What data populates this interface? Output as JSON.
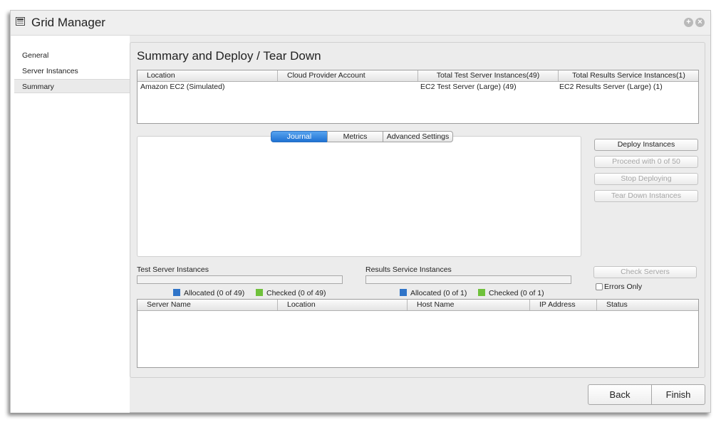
{
  "window": {
    "title": "Grid Manager",
    "icon": "grid-manager-icon"
  },
  "sidebar": {
    "items": [
      {
        "label": "General"
      },
      {
        "label": "Server Instances"
      },
      {
        "label": "Summary",
        "selected": true
      }
    ]
  },
  "main": {
    "title": "Summary and Deploy / Tear Down",
    "summary_table": {
      "columns": [
        "Location",
        "Cloud Provider Account",
        "Total Test Server Instances(49)",
        "Total Results Service Instances(1)"
      ],
      "rows": [
        [
          "Amazon EC2 (Simulated)",
          "",
          "EC2 Test Server (Large) (49)",
          "EC2 Results Server (Large) (1)"
        ]
      ]
    },
    "tabs": [
      {
        "label": "Journal",
        "active": true
      },
      {
        "label": "Metrics"
      },
      {
        "label": "Advanced Settings"
      }
    ],
    "actions": {
      "deploy": "Deploy Instances",
      "proceed": "Proceed with 0 of 50",
      "stop": "Stop Deploying",
      "teardown": "Tear Down Instances",
      "check_servers": "Check Servers",
      "errors_only": "Errors Only"
    },
    "test_server": {
      "label": "Test Server Instances",
      "allocated": "Allocated (0 of 49)",
      "checked": "Checked (0 of 49)",
      "progress": 0
    },
    "results_service": {
      "label": "Results Service Instances",
      "allocated": "Allocated (0 of 1)",
      "checked": "Checked (0 of 1)",
      "progress": 0
    },
    "server_table": {
      "columns": [
        "Server Name",
        "Location",
        "Host Name",
        "IP Address",
        "Status"
      ],
      "rows": []
    }
  },
  "footer": {
    "back": "Back",
    "finish": "Finish"
  },
  "colors": {
    "allocated": "#2f74c8",
    "checked": "#6fc13b",
    "tab_active": "#1f72d3"
  }
}
